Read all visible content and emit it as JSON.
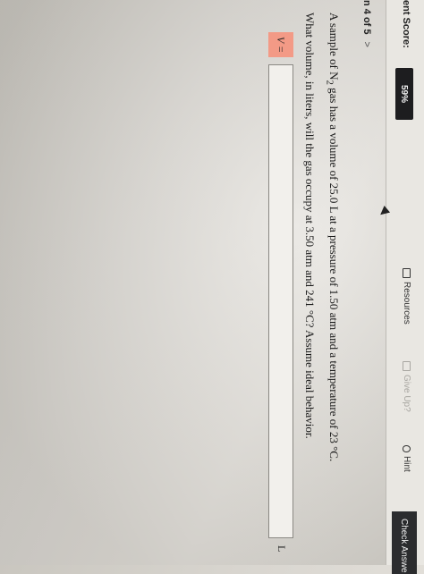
{
  "header": {
    "score_label": "ent Score:",
    "score_value": "59%",
    "resources": "Resources",
    "give_up": "Give Up?",
    "hint": "Hint",
    "check_answer": "Check Answe"
  },
  "nav": {
    "position": "n 4 of 5",
    "next": ">"
  },
  "question": {
    "line1_a": "A sample of N",
    "line1_sub": "2",
    "line1_b": " gas has a volume of 25.0 L at a pressure of 1.50 atm and a temperature of 23 °C.",
    "line2": "What volume, in liters, will the gas occupy at 3.50 atm and 241 °C? Assume ideal behavior."
  },
  "answer": {
    "label": "V =",
    "value": "",
    "unit": "L"
  },
  "colors": {
    "answer_label_bg": "#f39a86",
    "topbar_dark": "#1d1d1f"
  }
}
